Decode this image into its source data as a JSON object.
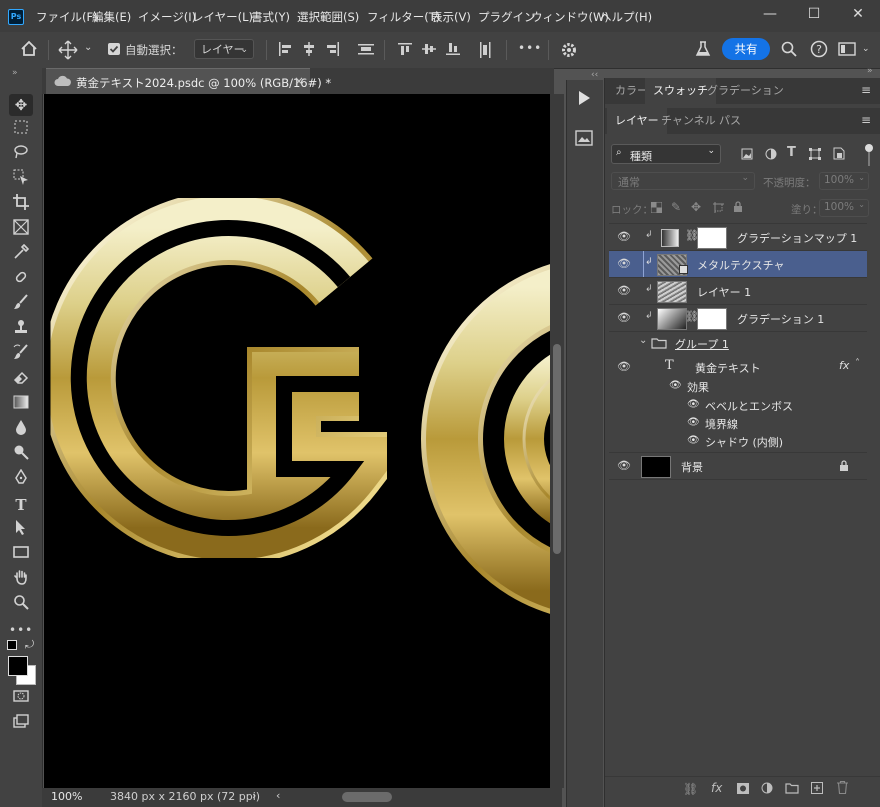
{
  "app": {
    "logo": "Ps"
  },
  "menu": [
    "ファイル(F)",
    "編集(E)",
    "イメージ(I)",
    "レイヤー(L)",
    "書式(Y)",
    "選択範囲(S)",
    "フィルター(T)",
    "表示(V)",
    "プラグイン",
    "ウィンドウ(W)",
    "ヘルプ(H)"
  ],
  "window_controls": {
    "minimize": "—",
    "maximize": "☐",
    "close": "✕"
  },
  "options": {
    "auto_select_label": "自動選択：",
    "auto_select_target": "レイヤー",
    "more": "•••",
    "share": "共有"
  },
  "document": {
    "tab_title": "黄金テキスト2024.psdc @ 100% (RGB/16#) *",
    "close": "×",
    "zoom": "100%",
    "dimensions": "3840 px x 2160 px (72 ppi)",
    "status_arrow": "›",
    "canvas_text": "GO"
  },
  "panels": {
    "top_tabs": [
      "カラー",
      "スウォッチ",
      "グラデーション"
    ],
    "top_active": "スウォッチ",
    "layer_tabs": [
      "レイヤー",
      "チャンネル",
      "パス"
    ],
    "layer_active": "レイヤー",
    "filter_kind": "種類",
    "blend_mode": "通常",
    "opacity_label": "不透明度：",
    "opacity_value": "100%",
    "lock_label": "ロック：",
    "fill_label": "塗り：",
    "fill_value": "100%"
  },
  "layers": [
    {
      "name": "グラデーションマップ 1",
      "type": "adjustment",
      "clipped": true,
      "selected": false
    },
    {
      "name": "メタルテクスチャ",
      "type": "smart",
      "clipped": true,
      "selected": true
    },
    {
      "name": "レイヤー 1",
      "type": "pixel",
      "clipped": true,
      "selected": false
    },
    {
      "name": "グラデーション 1",
      "type": "adjustment",
      "clipped": true,
      "selected": false
    },
    {
      "name": "グループ 1",
      "type": "group",
      "clipped": false,
      "selected": false
    },
    {
      "name": "黄金テキスト",
      "type": "text",
      "clipped": false,
      "selected": false,
      "fx": "fx"
    },
    {
      "name": "効果",
      "type": "effects-header"
    },
    {
      "name": "ベベルとエンボス",
      "type": "effect"
    },
    {
      "name": "境界線",
      "type": "effect"
    },
    {
      "name": "シャドウ (内側)",
      "type": "effect"
    },
    {
      "name": "背景",
      "type": "background",
      "locked": true
    }
  ],
  "colors": {
    "accent": "#1473e6",
    "selection": "#4a5f8e",
    "panel": "#424242",
    "menubar": "#3d3d3d"
  }
}
